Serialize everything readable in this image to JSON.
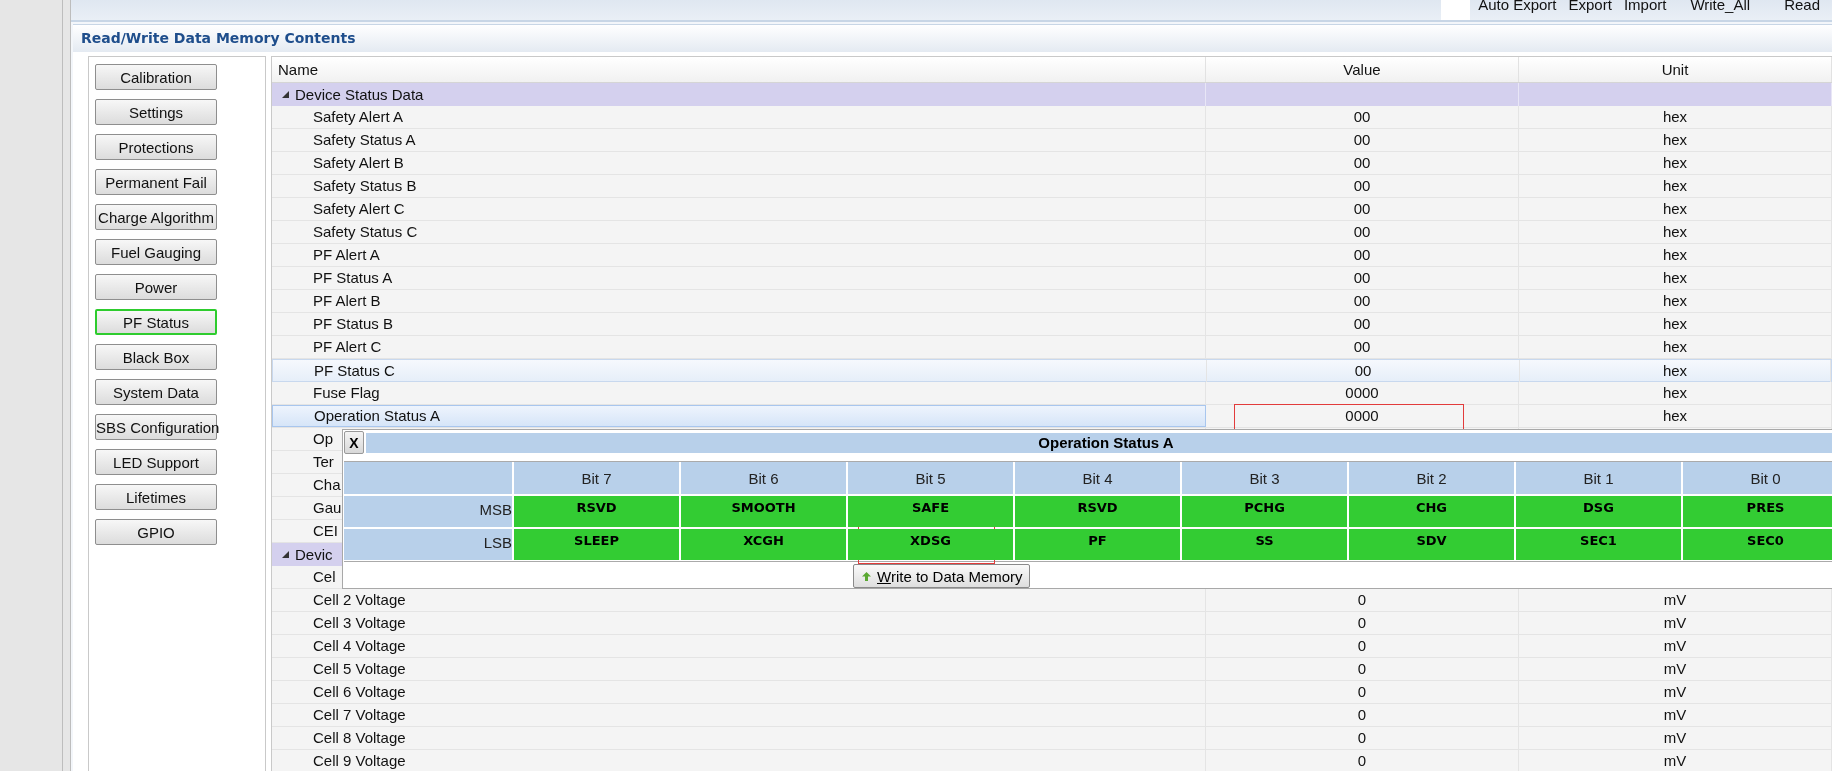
{
  "toolbar": {
    "actions": [
      "Auto Export",
      "Export",
      "Import",
      "Write_All",
      "Read"
    ]
  },
  "panel": {
    "title": "Read/Write Data Memory Contents"
  },
  "categories": [
    {
      "label": "Calibration",
      "selected": false
    },
    {
      "label": "Settings",
      "selected": false
    },
    {
      "label": "Protections",
      "selected": false
    },
    {
      "label": "Permanent Fail",
      "selected": false
    },
    {
      "label": "Charge Algorithm",
      "selected": false
    },
    {
      "label": "Fuel Gauging",
      "selected": false
    },
    {
      "label": "Power",
      "selected": false
    },
    {
      "label": "PF Status",
      "selected": true
    },
    {
      "label": "Black Box",
      "selected": false
    },
    {
      "label": "System Data",
      "selected": false
    },
    {
      "label": "SBS Configuration",
      "selected": false
    },
    {
      "label": "LED Support",
      "selected": false
    },
    {
      "label": "Lifetimes",
      "selected": false
    },
    {
      "label": "GPIO",
      "selected": false
    }
  ],
  "table": {
    "columns": [
      "Name",
      "Value",
      "Unit"
    ],
    "groups": [
      {
        "name": "Device Status Data",
        "expanded": true,
        "rows": [
          {
            "name": "Safety Alert A",
            "value": "00",
            "unit": "hex",
            "selected": false,
            "hovered": false
          },
          {
            "name": "Safety Status A",
            "value": "00",
            "unit": "hex",
            "selected": false,
            "hovered": false
          },
          {
            "name": "Safety Alert B",
            "value": "00",
            "unit": "hex",
            "selected": false,
            "hovered": false
          },
          {
            "name": "Safety Status B",
            "value": "00",
            "unit": "hex",
            "selected": false,
            "hovered": false
          },
          {
            "name": "Safety Alert C",
            "value": "00",
            "unit": "hex",
            "selected": false,
            "hovered": false
          },
          {
            "name": "Safety Status C",
            "value": "00",
            "unit": "hex",
            "selected": false,
            "hovered": false
          },
          {
            "name": "PF Alert A",
            "value": "00",
            "unit": "hex",
            "selected": false,
            "hovered": false
          },
          {
            "name": "PF Status A",
            "value": "00",
            "unit": "hex",
            "selected": false,
            "hovered": false
          },
          {
            "name": "PF Alert B",
            "value": "00",
            "unit": "hex",
            "selected": false,
            "hovered": false
          },
          {
            "name": "PF Status B",
            "value": "00",
            "unit": "hex",
            "selected": false,
            "hovered": false
          },
          {
            "name": "PF Alert C",
            "value": "00",
            "unit": "hex",
            "selected": false,
            "hovered": false
          },
          {
            "name": "PF Status C",
            "value": "00",
            "unit": "hex",
            "selected": false,
            "hovered": true
          },
          {
            "name": "Fuse Flag",
            "value": "0000",
            "unit": "hex",
            "selected": false,
            "hovered": false
          },
          {
            "name": "Operation Status A",
            "value": "0000",
            "unit": "hex",
            "selected": true,
            "hovered": false,
            "annotated": true
          },
          {
            "name": "Op",
            "selected": false,
            "hovered": false
          },
          {
            "name": "Ter",
            "selected": false,
            "hovered": false
          },
          {
            "name": "Cha",
            "selected": false,
            "hovered": false
          },
          {
            "name": "Gau",
            "selected": false,
            "hovered": false
          },
          {
            "name": "CEI",
            "selected": false,
            "hovered": false
          }
        ]
      },
      {
        "name": "Devic",
        "expanded": true,
        "rows": [
          {
            "name": "Cel",
            "selected": false,
            "hovered": false
          },
          {
            "name": "Cell 2 Voltage",
            "value": "0",
            "unit": "mV",
            "selected": false,
            "hovered": false
          },
          {
            "name": "Cell 3 Voltage",
            "value": "0",
            "unit": "mV",
            "selected": false,
            "hovered": false
          },
          {
            "name": "Cell 4 Voltage",
            "value": "0",
            "unit": "mV",
            "selected": false,
            "hovered": false
          },
          {
            "name": "Cell 5 Voltage",
            "value": "0",
            "unit": "mV",
            "selected": false,
            "hovered": false
          },
          {
            "name": "Cell 6 Voltage",
            "value": "0",
            "unit": "mV",
            "selected": false,
            "hovered": false
          },
          {
            "name": "Cell 7 Voltage",
            "value": "0",
            "unit": "mV",
            "selected": false,
            "hovered": false
          },
          {
            "name": "Cell 8 Voltage",
            "value": "0",
            "unit": "mV",
            "selected": false,
            "hovered": false
          },
          {
            "name": "Cell 9 Voltage",
            "value": "0",
            "unit": "mV",
            "selected": false,
            "hovered": false
          }
        ]
      }
    ]
  },
  "bit_editor": {
    "close": "X",
    "title": "Operation Status A",
    "bits": [
      "Bit 7",
      "Bit 6",
      "Bit 5",
      "Bit 4",
      "Bit 3",
      "Bit 2",
      "Bit 1",
      "Bit 0"
    ],
    "rows": [
      {
        "label": "MSB",
        "flags": [
          {
            "name": "RSVD"
          },
          {
            "name": "SMOOTH"
          },
          {
            "name": "SAFE"
          },
          {
            "name": "RSVD"
          },
          {
            "name": "PCHG"
          },
          {
            "name": "CHG"
          },
          {
            "name": "DSG"
          },
          {
            "name": "PRES"
          }
        ]
      },
      {
        "label": "LSB",
        "flags": [
          {
            "name": "SLEEP"
          },
          {
            "name": "XCGH"
          },
          {
            "name": "XDSG",
            "annotated": true
          },
          {
            "name": "PF"
          },
          {
            "name": "SS"
          },
          {
            "name": "SDV"
          },
          {
            "name": "SEC1"
          },
          {
            "name": "SEC0"
          }
        ]
      }
    ],
    "write_button": "Write to Data Memory"
  }
}
